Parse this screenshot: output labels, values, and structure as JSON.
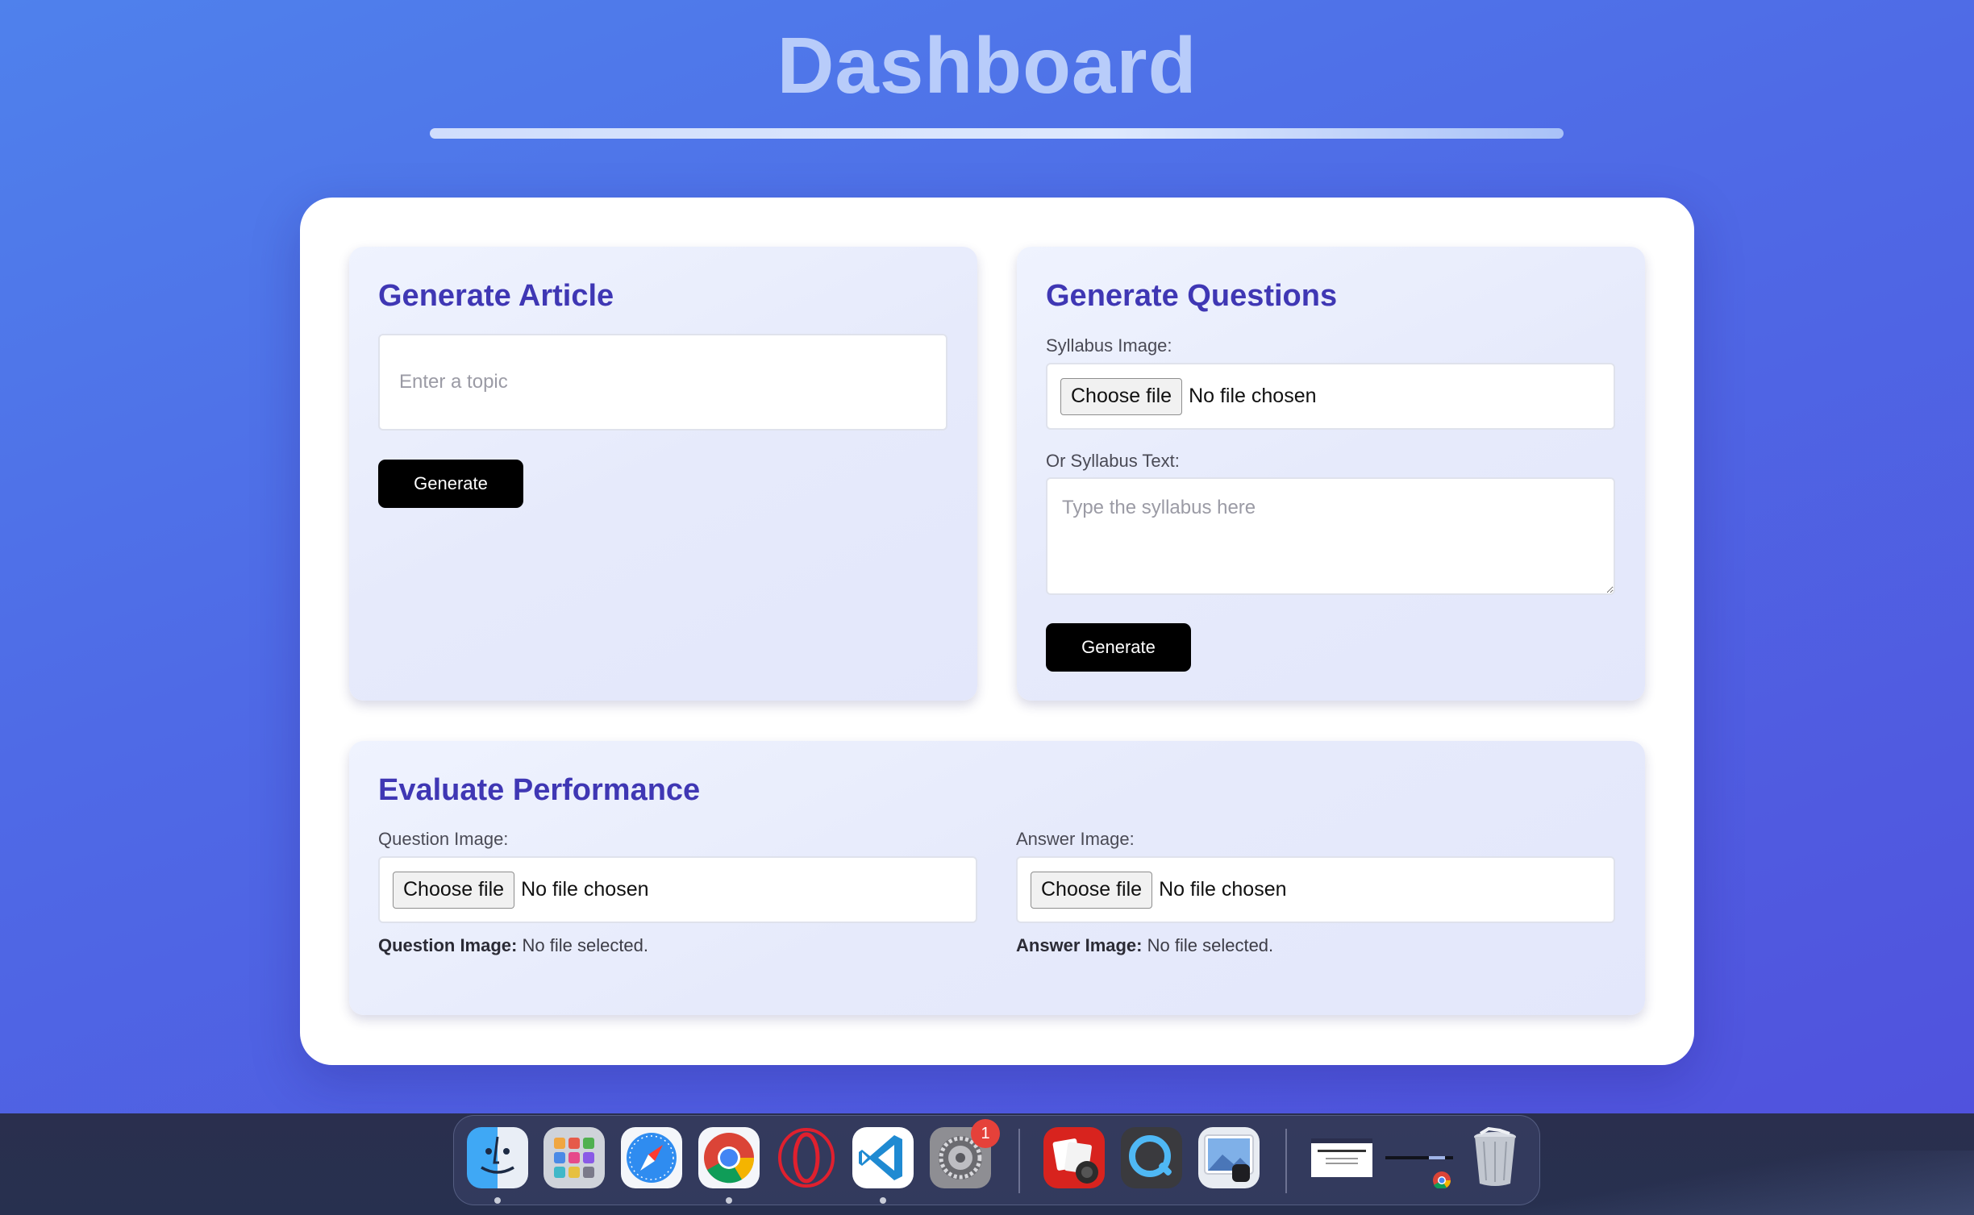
{
  "header": {
    "title": "Dashboard"
  },
  "generate_article": {
    "title": "Generate Article",
    "topic_placeholder": "Enter a topic",
    "button_label": "Generate"
  },
  "generate_questions": {
    "title": "Generate Questions",
    "syllabus_image_label": "Syllabus Image:",
    "choose_file_label": "Choose file",
    "file_status": "No file chosen",
    "syllabus_text_label": "Or Syllabus Text:",
    "syllabus_text_placeholder": "Type the syllabus here",
    "button_label": "Generate"
  },
  "evaluate_performance": {
    "title": "Evaluate Performance",
    "question_image_label": "Question Image:",
    "answer_image_label": "Answer Image:",
    "choose_file_label": "Choose file",
    "file_status": "No file chosen",
    "question_selected_label": "Question Image:",
    "question_selected_value": "No file selected.",
    "answer_selected_label": "Answer Image:",
    "answer_selected_value": "No file selected."
  },
  "dock": {
    "items": [
      {
        "name": "Finder",
        "icon": "finder-icon",
        "running": true
      },
      {
        "name": "Launchpad",
        "icon": "launchpad-icon",
        "running": false
      },
      {
        "name": "Safari",
        "icon": "safari-icon",
        "running": false
      },
      {
        "name": "Google Chrome",
        "icon": "chrome-icon",
        "running": true
      },
      {
        "name": "Opera",
        "icon": "opera-icon",
        "running": false
      },
      {
        "name": "Visual Studio Code",
        "icon": "vscode-icon",
        "running": true
      },
      {
        "name": "System Settings",
        "icon": "settings-icon",
        "running": false,
        "badge": "1"
      },
      {
        "name": "Photo Booth",
        "icon": "photo-booth-icon",
        "running": false
      },
      {
        "name": "QuickTime Player",
        "icon": "quicktime-icon",
        "running": false
      },
      {
        "name": "Preview",
        "icon": "preview-icon",
        "running": false
      },
      {
        "name": "Window Thumbnail",
        "icon": "window-thumbnail-icon",
        "running": false
      },
      {
        "name": "Chrome Window Thumbnail",
        "icon": "chrome-window-thumbnail-icon",
        "running": false
      },
      {
        "name": "Trash",
        "icon": "trash-icon",
        "running": false
      }
    ],
    "settings_badge": "1"
  },
  "colors": {
    "background_start": "#4f81ec",
    "background_end": "#5050dc",
    "title_color": "#b8ccfa",
    "panel_title_color": "#3f37b4",
    "button_bg": "#000000"
  }
}
